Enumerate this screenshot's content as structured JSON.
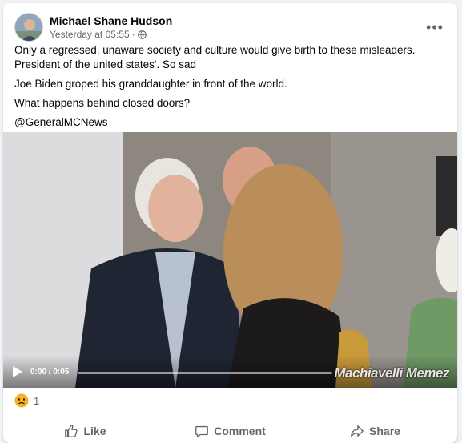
{
  "post": {
    "author": "Michael Shane Hudson",
    "timestamp": "Yesterday at 05:55",
    "separator": "·",
    "privacy_icon": "globe-icon",
    "more_icon": "more-horizontal-icon",
    "text_lines": [
      "Only a regressed, unaware society and culture would give birth to these misleaders. President of the united states'. So sad",
      "Joe Biden groped his granddaughter in front of the world.",
      "What happens behind closed doors?",
      "@GeneralMCNews"
    ]
  },
  "video": {
    "time": "0:00 / 0:05",
    "progress": 0,
    "watermark": "Machiavelli Memez",
    "play_icon": "play-icon"
  },
  "reactions": {
    "icon": "sad-reaction-icon",
    "count": "1"
  },
  "actions": {
    "like": "Like",
    "comment": "Comment",
    "share": "Share"
  },
  "colors": {
    "secondary_text": "#65676b",
    "divider": "#ced0d4",
    "background": "#f0f2f5"
  }
}
